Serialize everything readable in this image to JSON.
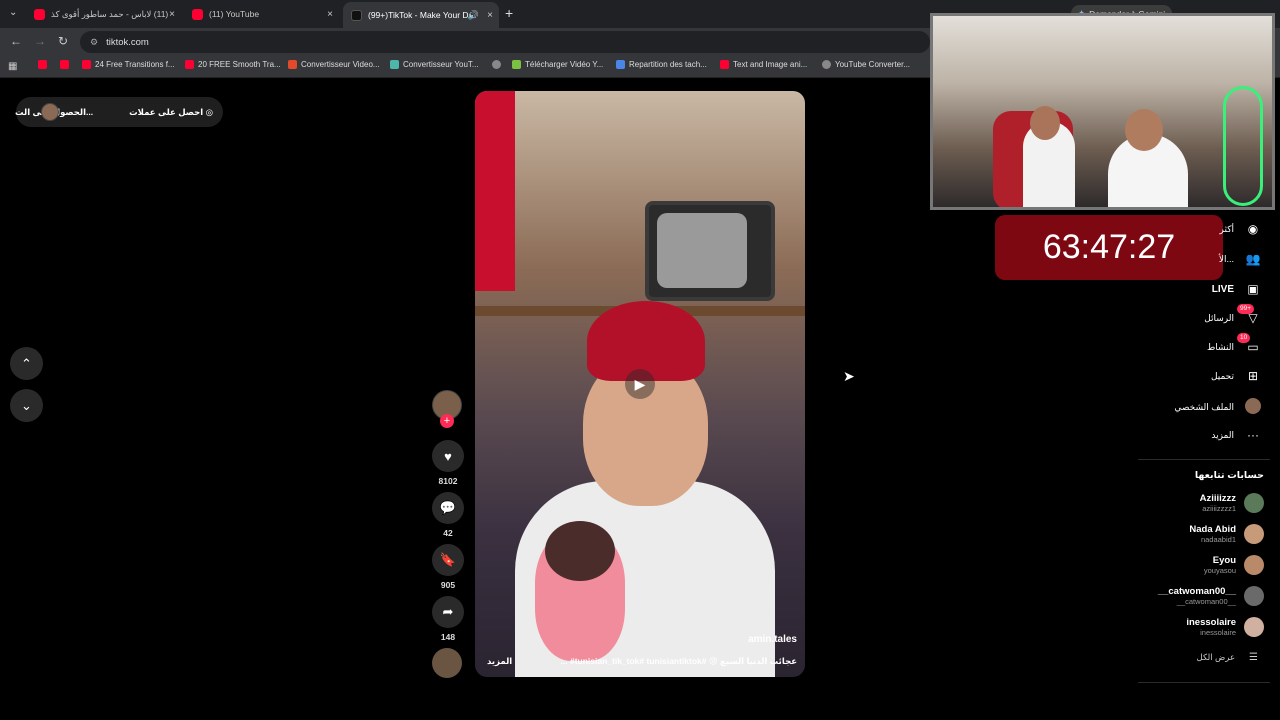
{
  "browser": {
    "tabs": [
      {
        "title": "(11) لاباس - حمد ساطور أقوى كذ",
        "close": "×"
      },
      {
        "title": "(11) YouTube",
        "close": "×"
      },
      {
        "title": "(99+)TikTok - Make Your Da",
        "close": "×"
      }
    ],
    "tab_menu": "⌄",
    "new_tab": "+",
    "gemini": "Demander à Gemini",
    "url": "tiktok.com",
    "bookmarks": [
      "24 Free Transitions f...",
      "20 FREE Smooth Tra...",
      "Convertisseur Video...",
      "Convertisseur YouT...",
      "Télécharger Vidéo Y...",
      "Repartition des tach...",
      "Text and Image ani...",
      "YouTube Converter..."
    ]
  },
  "top_pill": {
    "coins": "احصل على عملات",
    "app": "الحصول على الت..."
  },
  "video": {
    "author": "amin.tales",
    "caption": "عجائب الدنيا السبع 😝 #tunisian_tik_tok# tunisiantiktok# ...",
    "more": "المزيد"
  },
  "actions": {
    "likes": "8102",
    "comments": "42",
    "saves": "905",
    "shares": "148"
  },
  "timer": "63:47:27",
  "sidebar": {
    "items": [
      {
        "label": "أكثر",
        "icon": "explore-icon"
      },
      {
        "label": "الأ...",
        "icon": "people-icon"
      },
      {
        "label": "LIVE",
        "icon": "live-icon"
      },
      {
        "label": "الرسائل",
        "icon": "messages-icon",
        "badge": "99+"
      },
      {
        "label": "النشاط",
        "icon": "activity-icon",
        "badge": "10"
      },
      {
        "label": "تحميل",
        "icon": "upload-icon"
      },
      {
        "label": "الملف الشخصي",
        "icon": "profile-icon"
      },
      {
        "label": "المزيد",
        "icon": "more-icon"
      }
    ],
    "following_title": "حسابات تتابعها",
    "accounts": [
      {
        "name": "Aziiiizzz",
        "user": "aziiiizzzz1",
        "color": "#5a7a5a"
      },
      {
        "name": "Nada Abid",
        "user": "nadaabid1",
        "color": "#c79a7a"
      },
      {
        "name": "Eyou",
        "user": "youyasou",
        "color": "#b88a6a"
      },
      {
        "name": "__catwoman00__",
        "user": "__catwoman00__",
        "color": "#6a6a6a"
      },
      {
        "name": "inessolaire",
        "user": "inessolaire",
        "color": "#d0b0a0"
      }
    ],
    "see_all": "عرض الكل"
  }
}
